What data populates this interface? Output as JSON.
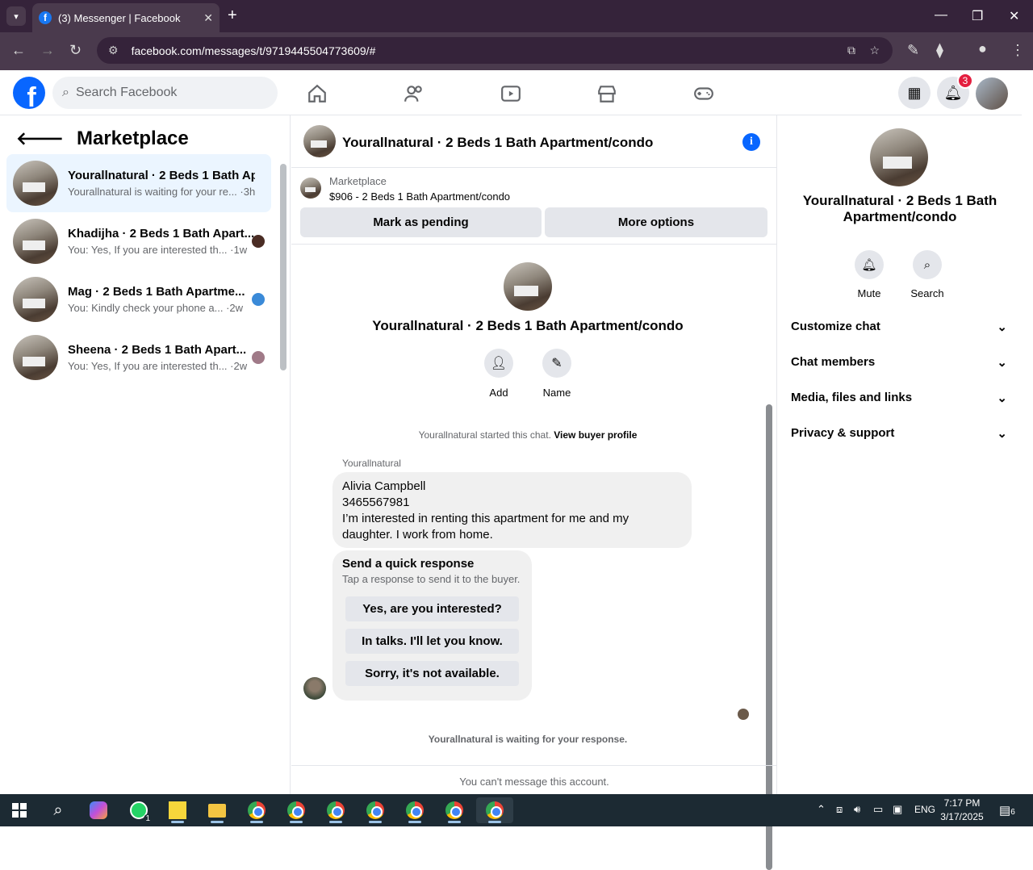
{
  "browser": {
    "tab_title": "(3) Messenger | Facebook",
    "url_domain": "facebook.com",
    "url_path": "/messages/t/9719445504773609/#",
    "favicon": "f"
  },
  "facebook": {
    "search_placeholder": "Search Facebook",
    "notification_count": "3"
  },
  "left": {
    "header": "Marketplace",
    "conversations": [
      {
        "name": "Yourallnatural · 2 Beds 1 Bath Ap...",
        "preview": "Yourallnatural is waiting for your re... ·3h",
        "active": true
      },
      {
        "name": "Khadijha · 2 Beds 1 Bath Apart...",
        "preview": "You: Yes, If you are interested th... ·1w",
        "active": false
      },
      {
        "name": "Mag · 2 Beds 1 Bath Apartme...",
        "preview": "You: Kindly check your phone a... ·2w",
        "active": false
      },
      {
        "name": "Sheena · 2 Beds 1 Bath Apart...",
        "preview": "You: Yes, If you are interested th... ·2w",
        "active": false
      }
    ]
  },
  "chat": {
    "title": "Yourallnatural · 2 Beds 1 Bath Apartment/condo",
    "marketplace_label": "Marketplace",
    "listing": "$906 - 2 Beds 1 Bath Apartment/condo",
    "mark_pending": "Mark as pending",
    "more_options": "More options",
    "add_label": "Add",
    "name_label": "Name",
    "started_text": "Yourallnatural started this chat.",
    "view_profile": "View buyer profile",
    "sender": "Yourallnatural",
    "message_lines": [
      "Alivia Campbell",
      "3465567981",
      "I’m interested in renting this apartment for me and my",
      "daughter. I work from home."
    ],
    "quick_title": "Send a quick response",
    "quick_sub": "Tap a response to send it to the buyer.",
    "quick_replies": [
      "Yes, are you interested?",
      "In talks. I'll let you know.",
      "Sorry, it's not available."
    ],
    "waiting": "Yourallnatural is waiting for your response.",
    "cant_message": "You can't message this account."
  },
  "right": {
    "title": "Yourallnatural · 2 Beds 1 Bath Apartment/condo",
    "mute": "Mute",
    "search": "Search",
    "sections": [
      "Customize chat",
      "Chat members",
      "Media, files and links",
      "Privacy & support"
    ]
  },
  "taskbar": {
    "time": "7:17 PM",
    "date": "3/17/2025",
    "lang": "ENG",
    "whatsapp_badge": "1",
    "notif_count": "6"
  }
}
